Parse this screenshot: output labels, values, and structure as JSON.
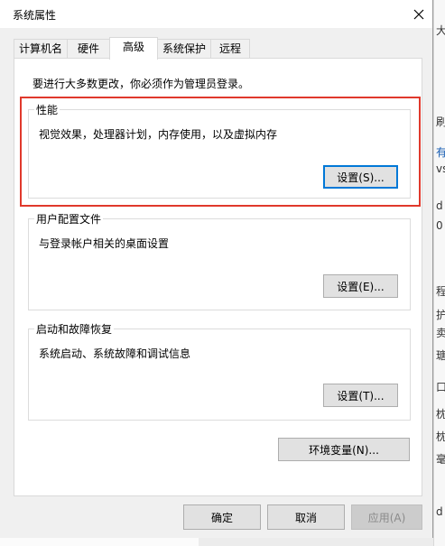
{
  "window": {
    "title": "系统属性"
  },
  "tabs": [
    {
      "label": "计算机名",
      "active": false
    },
    {
      "label": "硬件",
      "active": false
    },
    {
      "label": "高级",
      "active": true
    },
    {
      "label": "系统保护",
      "active": false
    },
    {
      "label": "远程",
      "active": false
    }
  ],
  "notice": "要进行大多数更改，你必须作为管理员登录。",
  "performance": {
    "label": "性能",
    "description": "视觉效果，处理器计划，内存使用，以及虚拟内存",
    "button": "设置(S)..."
  },
  "user_profiles": {
    "label": "用户配置文件",
    "description": "与登录帐户相关的桌面设置",
    "button": "设置(E)..."
  },
  "startup_recovery": {
    "label": "启动和故障恢复",
    "description": "系统启动、系统故障和调试信息",
    "button": "设置(T)..."
  },
  "env_button": "环境变量(N)...",
  "footer": {
    "ok": "确定",
    "cancel": "取消",
    "apply": "应用(A)"
  },
  "background_fragments": [
    "大",
    "刷",
    "有",
    "vs",
    "d",
    "0",
    "程",
    "护",
    "卖",
    "瑭",
    "口",
    "枕",
    "枕",
    "毫",
    "d"
  ],
  "colors": {
    "highlight": "#e0392c",
    "focus": "#0078d7",
    "dialog_bg": "#f0f0f0"
  }
}
